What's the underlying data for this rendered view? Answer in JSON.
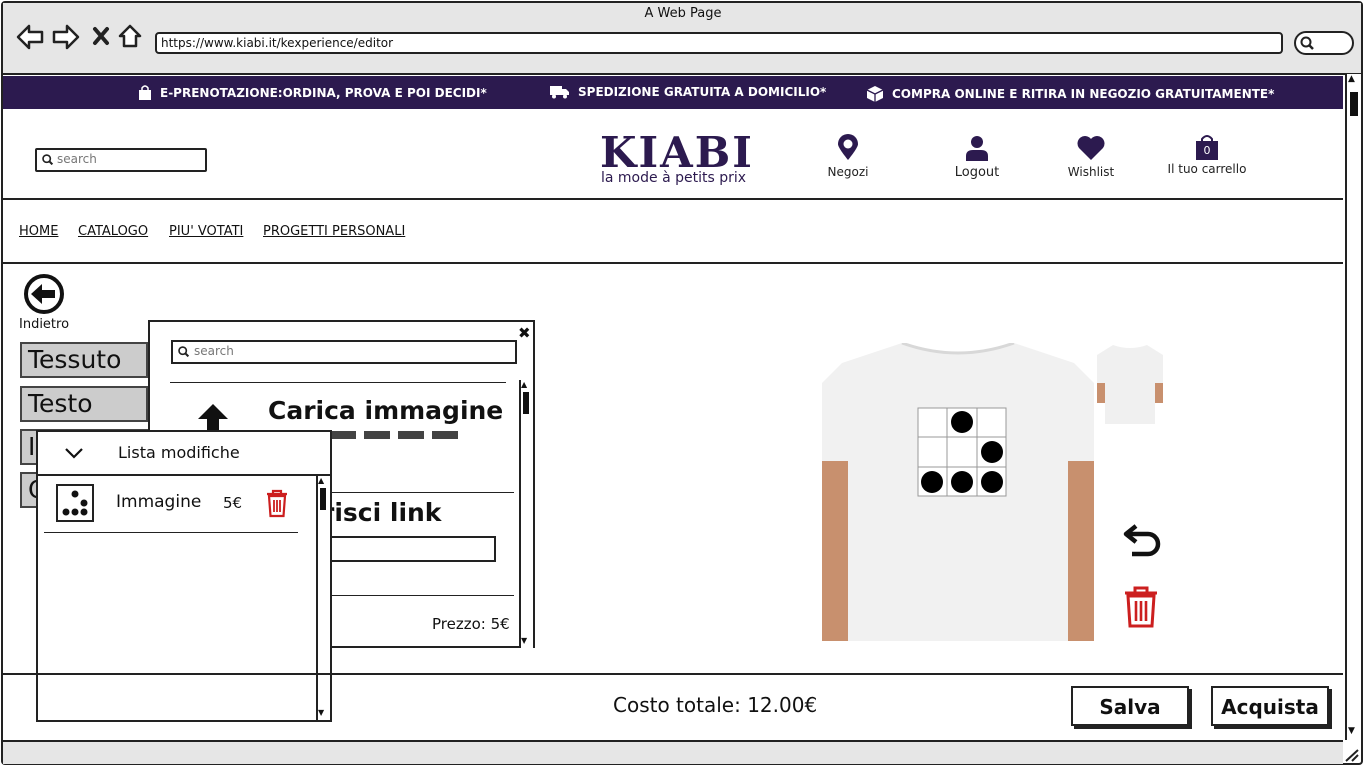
{
  "browser": {
    "window_title": "A Web Page",
    "url": "https://www.kiabi.it/kexperience/editor"
  },
  "promo": [
    "E-PRENOTAZIONE:ORDINA, PROVA E POI DECIDI*",
    "SPEDIZIONE GRATUITA A DOMICILIO*",
    "COMPRA ONLINE E RITIRA IN NEGOZIO GRATUITAMENTE*"
  ],
  "header": {
    "search_placeholder": "search",
    "logo": "KIABI",
    "tagline": "la mode à petits prix",
    "negozi": "Negozi",
    "logout": "Logout",
    "wishlist": "Wishlist",
    "cart": "Il tuo carrello",
    "cart_count": "0"
  },
  "menu": [
    "HOME",
    "CATALOGO",
    "PIU' VOTATI",
    "PROGETTI PERSONALI"
  ],
  "back_label": "Indietro",
  "sidebar": [
    "Tessuto",
    "Testo",
    "I",
    "C"
  ],
  "image_panel": {
    "search_placeholder": "search",
    "upload_title": "Carica immagine",
    "link_title": "risci link",
    "price": "Prezzo: 5€"
  },
  "mods_panel": {
    "title": "Lista modifiche",
    "items": [
      {
        "name": "Immagine",
        "price": "5€"
      }
    ]
  },
  "footer": {
    "total": "Costo totale: 12.00€",
    "save": "Salva",
    "buy": "Acquista"
  },
  "colors": {
    "brand": "#2c1a4f",
    "delete": "#cc1f1f"
  }
}
